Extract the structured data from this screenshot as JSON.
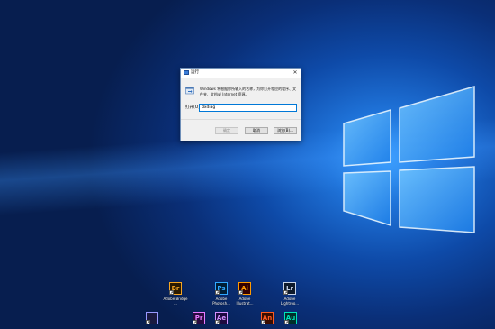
{
  "dialog": {
    "title": "运行",
    "description": "Windows 将根据你所输入的名称，为你打开相应的程序、文件夹、文档或 Internet 资源。",
    "open_label": "打开(O):",
    "input_value": "dxdiag",
    "ok_label": "确定",
    "cancel_label": "取消",
    "browse_label": "浏览(B)..."
  },
  "desktop_icons": [
    {
      "abbr": "Br",
      "label": "Adobe Bridge ...",
      "color": "#f5a623",
      "bg": "#2b1a00"
    },
    {
      "abbr": "Ps",
      "label": "Adobe Photosh...",
      "color": "#31a8ff",
      "bg": "#001e36"
    },
    {
      "abbr": "Ai",
      "label": "Adobe Illustrat...",
      "color": "#ff9a00",
      "bg": "#330000"
    },
    {
      "abbr": "Lr",
      "label": "Adobe Lightroo...",
      "color": "#c7d3e8",
      "bg": "#0e1a2b"
    },
    {
      "abbr": "",
      "label": "",
      "color": "#9999ff",
      "bg": "#1a1a40"
    },
    {
      "abbr": "Pr",
      "label": "",
      "color": "#e77bff",
      "bg": "#2a0a40"
    },
    {
      "abbr": "Ae",
      "label": "",
      "color": "#d291ff",
      "bg": "#1e0a40"
    },
    {
      "abbr": "An",
      "label": "",
      "color": "#ff5b22",
      "bg": "#3a0d00"
    },
    {
      "abbr": "Au",
      "label": "",
      "color": "#00e4bb",
      "bg": "#00302a"
    }
  ]
}
